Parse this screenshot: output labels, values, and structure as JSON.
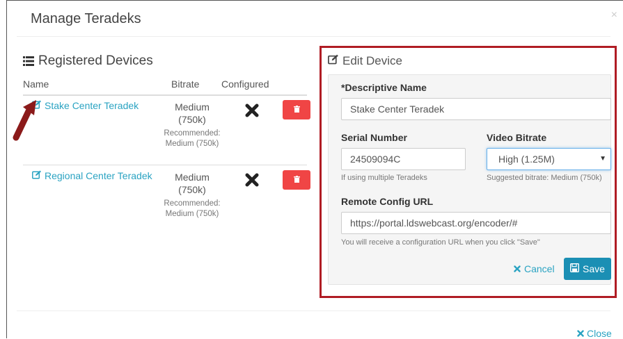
{
  "modal": {
    "title": "Manage Teradeks",
    "close_x": "×",
    "footer_close_label": "Close"
  },
  "registered": {
    "title": "Registered Devices",
    "columns": {
      "name": "Name",
      "bitrate": "Bitrate",
      "configured": "Configured"
    },
    "devices": [
      {
        "name": "Stake Center Teradek",
        "bitrate": "Medium (750k)",
        "recommended": "Recommended: Medium (750k)",
        "configured": false
      },
      {
        "name": "Regional Center Teradek",
        "bitrate": "Medium (750k)",
        "recommended": "Recommended: Medium (750k)",
        "configured": false
      }
    ]
  },
  "edit": {
    "title": "Edit Device",
    "descriptive_name": {
      "label": "*Descriptive Name",
      "value": "Stake Center Teradek"
    },
    "serial": {
      "label": "Serial Number",
      "value": "24509094C",
      "help": "If using multiple Teradeks"
    },
    "video_bitrate": {
      "label": "Video Bitrate",
      "value": "High (1.25M)",
      "help": "Suggested bitrate: Medium (750k)"
    },
    "remote_config": {
      "label": "Remote Config URL",
      "value": "https://portal.ldswebcast.org/encoder/#",
      "help": "You will receive a configuration URL when you click \"Save\""
    },
    "cancel_label": "Cancel",
    "save_label": "Save"
  },
  "colors": {
    "link": "#2aa3c2",
    "danger": "#f04545",
    "primary": "#1b8fb4",
    "highlight_border": "#b01c24",
    "arrow": "#8b1a1a"
  },
  "icons": {
    "list": "list-icon",
    "edit": "edit-icon",
    "configured_no": "x-mark-icon",
    "delete": "trash-icon",
    "cancel": "times-icon",
    "save": "floppy-icon",
    "annotation": "arrow-icon"
  }
}
